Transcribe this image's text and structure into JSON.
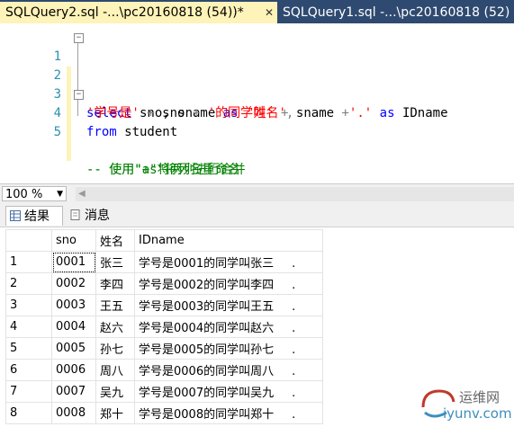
{
  "tabs": [
    {
      "label": "SQLQuery2.sql -...\\pc20160818 (54))*",
      "active": true
    },
    {
      "label": "SQLQuery1.sql -...\\pc20160818 (52)",
      "active": false
    }
  ],
  "tab_close": "✕",
  "editor": {
    "lines": [
      {
        "num": "1"
      },
      {
        "num": "2"
      },
      {
        "num": "3"
      },
      {
        "num": "4"
      },
      {
        "num": "5"
      }
    ],
    "l1": {
      "a": "select",
      "b": " sno, sname ",
      "c": "as",
      "d": " '姓名'",
      "e": ","
    },
    "l2": {
      "a": "'学号是'",
      "b": " + ",
      "c": "sno",
      "d": " + ",
      "e": "'的同学叫'",
      "f": " + ",
      "g": "sname",
      "h": " +",
      "i": "'.'",
      "j": " as ",
      "k": "IDname"
    },
    "l3": {
      "a": "from",
      "b": " student"
    },
    "l4": "-- 使用\"+\"将两列进行合并",
    "l5": "-- 使用\"as\"将列名重命名"
  },
  "zoom": {
    "value": "100 %"
  },
  "result_tabs": {
    "results": "结果",
    "messages": "消息"
  },
  "grid": {
    "columns": [
      "sno",
      "姓名",
      "IDname"
    ],
    "rows": [
      {
        "n": "1",
        "sno": "0001",
        "name": "张三",
        "id": "学号是0001的同学叫张三",
        "dot": "."
      },
      {
        "n": "2",
        "sno": "0002",
        "name": "李四",
        "id": "学号是0002的同学叫李四",
        "dot": "."
      },
      {
        "n": "3",
        "sno": "0003",
        "name": "王五",
        "id": "学号是0003的同学叫王五",
        "dot": "."
      },
      {
        "n": "4",
        "sno": "0004",
        "name": "赵六",
        "id": "学号是0004的同学叫赵六",
        "dot": "."
      },
      {
        "n": "5",
        "sno": "0005",
        "name": "孙七",
        "id": "学号是0005的同学叫孙七",
        "dot": "."
      },
      {
        "n": "6",
        "sno": "0006",
        "name": "周八",
        "id": "学号是0006的同学叫周八",
        "dot": "."
      },
      {
        "n": "7",
        "sno": "0007",
        "name": "吴九",
        "id": "学号是0007的同学叫吴九",
        "dot": "."
      },
      {
        "n": "8",
        "sno": "0008",
        "name": "郑十",
        "id": "学号是0008的同学叫郑十",
        "dot": "."
      }
    ]
  },
  "watermark": {
    "cn": "运维网",
    "url": "iyunv.com"
  },
  "colors": {
    "tab_bar": "#2f4a70",
    "active_tab": "#fef3b8",
    "keyword": "#0000ff",
    "string": "#ff0000",
    "comment": "#008000",
    "line_number": "#2b91af"
  }
}
